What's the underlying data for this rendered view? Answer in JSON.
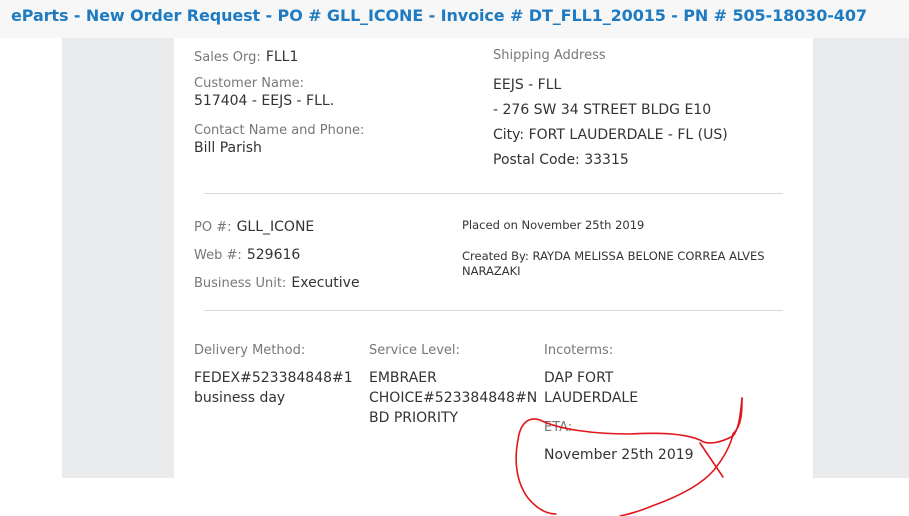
{
  "header": {
    "title": "eParts - New Order Request - PO # GLL_ICONE - Invoice # DT_FLL1_20015 - PN # 505-18030-407"
  },
  "customer": {
    "sales_org_label": "Sales Org:",
    "sales_org_value": "FLL1",
    "customer_name_label": "Customer Name:",
    "customer_name_value": "517404 - EEJS - FLL.",
    "contact_label": "Contact Name and Phone:",
    "contact_value": "Bill Parish"
  },
  "shipping": {
    "label": "Shipping Address",
    "line1": "EEJS - FLL",
    "line2": "- 276 SW 34 STREET BLDG E10",
    "line3": "City: FORT LAUDERDALE - FL (US)",
    "line4": "Postal Code: 33315"
  },
  "order": {
    "po_label": "PO #:",
    "po_value": "GLL_ICONE",
    "web_label": "Web #:",
    "web_value": "529616",
    "bu_label": "Business Unit:",
    "bu_value": "Executive",
    "placed_on": "Placed on November 25th 2019",
    "created_by_line1": "Created By: RAYDA MELISSA BELONE CORREA ALVES",
    "created_by_line2": "NARAZAKI"
  },
  "delivery": {
    "method_label": "Delivery Method:",
    "method_line1": "FEDEX#523384848#1",
    "method_line2": "business day",
    "service_label": "Service Level:",
    "service_line1": "EMBRAER",
    "service_line2": "CHOICE#523384848#N",
    "service_line3": "BD PRIORITY",
    "incoterms_label": "Incoterms:",
    "incoterms_line1": "DAP FORT",
    "incoterms_line2": "LAUDERDALE",
    "eta_label": "ETA:",
    "eta_value": "November 25th 2019"
  },
  "colors": {
    "title": "#1f7bc1",
    "annotation": "#e0161b",
    "side_panel": "#e9eaec"
  }
}
